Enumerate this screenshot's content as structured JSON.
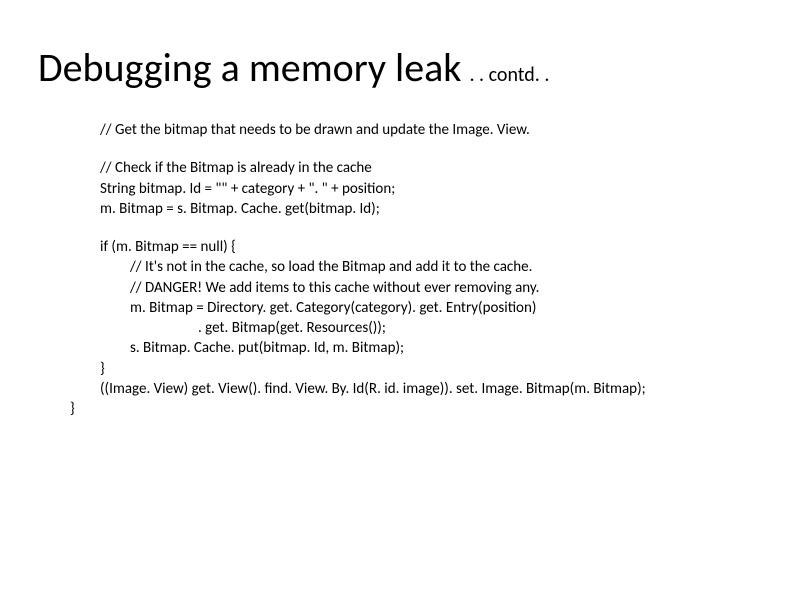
{
  "title": {
    "main": "Debugging a memory leak",
    "sub": ". . contd. ."
  },
  "code": {
    "l1": "// Get the bitmap that needs to be drawn and update the Image. View.",
    "l2": "// Check if the Bitmap is already in the cache",
    "l3": "String bitmap. Id = \"\" + category + \". \" + position;",
    "l4": "m. Bitmap = s. Bitmap. Cache. get(bitmap. Id);",
    "l5": "if (m. Bitmap == null) {",
    "l6": "// It's not in the cache, so load the Bitmap and add it to the cache.",
    "l7": "// DANGER! We add items to this cache without ever removing any.",
    "l8": "m. Bitmap = Directory. get. Category(category). get. Entry(position)",
    "l9": ". get. Bitmap(get. Resources());",
    "l10": "s. Bitmap. Cache. put(bitmap. Id, m. Bitmap);",
    "l11": "}",
    "l12": "((Image. View) get. View(). find. View. By. Id(R. id. image)). set. Image. Bitmap(m. Bitmap);",
    "l13": "}"
  }
}
